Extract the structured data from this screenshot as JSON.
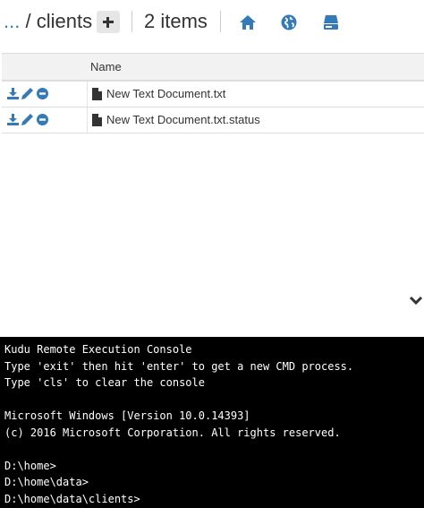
{
  "toolbar": {
    "path_dots": "...",
    "path_separator": "/",
    "folder": "clients",
    "item_count": "2 items",
    "icons": [
      "plus-icon",
      "home-icon",
      "globe-icon",
      "drive-icon"
    ],
    "accent": "#337ab7"
  },
  "table": {
    "columns": [
      "",
      "Name"
    ],
    "rows": [
      {
        "name": "New Text Document.txt",
        "actions": [
          "download-icon",
          "edit-icon",
          "delete-icon"
        ]
      },
      {
        "name": "New Text Document.txt.status",
        "actions": [
          "download-icon",
          "edit-icon",
          "delete-icon"
        ]
      }
    ]
  },
  "console": {
    "lines": [
      "Kudu Remote Execution Console",
      "Type 'exit' then hit 'enter' to get a new CMD process.",
      "Type 'cls' to clear the console",
      "",
      "Microsoft Windows [Version 10.0.14393]",
      "(c) 2016 Microsoft Corporation. All rights reserved.",
      "",
      "D:\\home>",
      "D:\\home\\data>",
      "D:\\home\\data\\clients>"
    ]
  }
}
